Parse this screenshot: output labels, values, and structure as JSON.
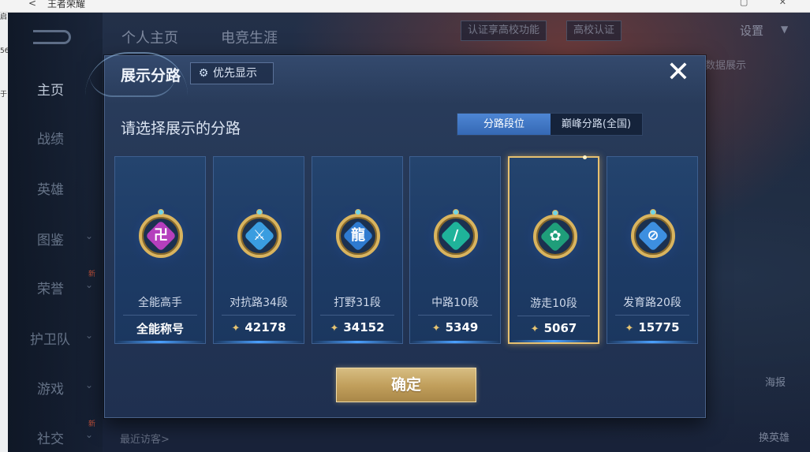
{
  "host": {
    "title": "王者荣耀",
    "back": "<",
    "controls": "▢ ✕",
    "left_chars": [
      "启",
      "56",
      "于"
    ]
  },
  "background": {
    "nav": [
      {
        "label": "主页",
        "active": true,
        "chevron": false,
        "new": false
      },
      {
        "label": "战绩",
        "active": false,
        "chevron": false,
        "new": false
      },
      {
        "label": "英雄",
        "active": false,
        "chevron": false,
        "new": false
      },
      {
        "label": "图鉴",
        "active": false,
        "chevron": true,
        "new": false
      },
      {
        "label": "荣誉",
        "active": false,
        "chevron": true,
        "new": true
      },
      {
        "label": "护卫队",
        "active": false,
        "chevron": true,
        "new": false
      },
      {
        "label": "游戏",
        "active": false,
        "chevron": true,
        "new": false
      },
      {
        "label": "社交",
        "active": false,
        "chevron": true,
        "new": true
      }
    ],
    "new_tag": "新",
    "chevron": "⌄",
    "tabs": [
      "个人主页",
      "电竞生涯"
    ],
    "verify_banner": "认证享高校功能",
    "campus_verify": "高校认证",
    "settings": "设置",
    "data_display_hint": "定和数据展示",
    "recent_visitors": "最近访客>",
    "poster": "海报",
    "swap_hero": "换英雄"
  },
  "dialog": {
    "title": "展示分路",
    "priority_button": "优先显示",
    "close": "✕",
    "subtitle": "请选择展示的分路",
    "segments": [
      {
        "label": "分路段位",
        "active": true
      },
      {
        "label": "巅峰分路(全国)",
        "active": false
      }
    ],
    "lanes": [
      {
        "name": "全能高手",
        "value": "全能称号",
        "has_score_icon": false,
        "selected": false,
        "badge_color": "#b53fbd",
        "glyph": "卍"
      },
      {
        "name": "对抗路34段",
        "value": "42178",
        "has_score_icon": true,
        "selected": false,
        "badge_color": "#3a9de0",
        "glyph": "⚔"
      },
      {
        "name": "打野31段",
        "value": "34152",
        "has_score_icon": true,
        "selected": false,
        "badge_color": "#2f7bd0",
        "glyph": "龍"
      },
      {
        "name": "中路10段",
        "value": "5349",
        "has_score_icon": true,
        "selected": false,
        "badge_color": "#1fb39a",
        "glyph": "∕"
      },
      {
        "name": "游走10段",
        "value": "5067",
        "has_score_icon": true,
        "selected": true,
        "badge_color": "#1f9e7a",
        "glyph": "✿"
      },
      {
        "name": "发育路20段",
        "value": "15775",
        "has_score_icon": true,
        "selected": false,
        "badge_color": "#3d8fe0",
        "glyph": "⊘"
      }
    ],
    "score_icon": "✦",
    "confirm": "确定"
  }
}
